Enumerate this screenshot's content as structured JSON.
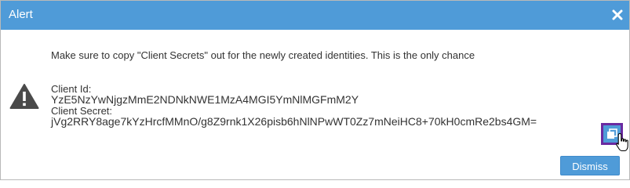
{
  "dialog": {
    "title": "Alert",
    "message": "Make sure to copy \"Client Secrets\" out for the newly created identities. This is the only chance",
    "client_id_label": "Client Id:",
    "client_id_value": "YzE5NzYwNjgzMmE2NDNkNWE1MzA4MGI5YmNlMGFmM2Y",
    "client_secret_label": "Client Secret:",
    "client_secret_value": "jVg2RRY8age7kYzHrcfMMnO/g8Z9rnk1X26pisb6hNlNPwWT0Zz7mNeiHC8+70kH0cmRe2bs4GM=",
    "dismiss_label": "Dismiss"
  },
  "icons": {
    "close": "close-icon",
    "warning": "warning-icon",
    "copy": "copy-icon",
    "cursor": "hand-cursor-icon"
  },
  "colors": {
    "titlebar": "#4f9bd8",
    "button": "#4f9bd8",
    "focus_outline": "#6a2aa0",
    "warning": "#4a4a4a"
  }
}
